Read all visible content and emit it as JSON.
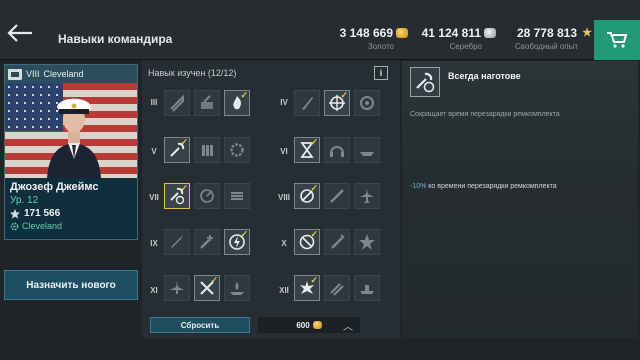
{
  "header": {
    "title": "Навыки командира",
    "back_icon": "back-arrow-icon",
    "cart_icon": "cart-icon"
  },
  "resources": {
    "gold": {
      "amount": "3 148 669",
      "label": "Золото",
      "icon": "gold-ingot-icon"
    },
    "silver": {
      "amount": "41 124 811",
      "label": "Серебро",
      "icon": "silver-coins-icon"
    },
    "free_xp": {
      "amount": "28 778 813",
      "label": "Свободный опыт",
      "icon": "free-xp-star-icon"
    }
  },
  "commander": {
    "tier": "VIII",
    "ship": "Cleveland",
    "name": "Джозеф Джеймс",
    "level": "Ур. 12",
    "xp": "171 566",
    "assigned_ship": "Cleveland",
    "nation_icon": "usa-flag-icon"
  },
  "assign_button_label": "Назначить нового",
  "skills": {
    "title": "Навык изучен (12/12)",
    "info_label": "i",
    "tiers": [
      "III",
      "IV",
      "V",
      "VI",
      "VII",
      "VIII",
      "IX",
      "X",
      "XI",
      "XII"
    ],
    "reset_label": "Сбросить",
    "reset_cost": "600",
    "collapse_icon": "chevron-up-icon"
  },
  "detail": {
    "title": "Всегда наготове",
    "icon": "wrench-repair-icon",
    "description": "Сокращает время перезарядки ремкомплекта",
    "effect_value": "-10%",
    "effect_text": " ко времени перезарядки ремкомплекта"
  },
  "colors": {
    "accent_green": "#1f9a74",
    "learned_tick": "#e8c24a",
    "level_text": "#5dd2a8",
    "effect_accent": "#5fb6d8"
  }
}
